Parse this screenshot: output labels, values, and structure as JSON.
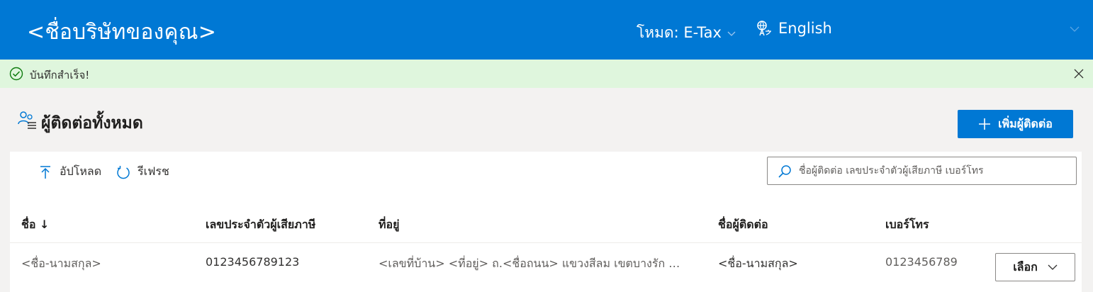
{
  "header": {
    "brand": "<ชื่อบริษัทของคุณ>",
    "mode_label": "โหมด: E-Tax",
    "language": "English",
    "icons": {
      "mode_dropdown": "chevron-down-icon",
      "language": "globe-translate-icon",
      "collapse": "chevron-down-icon"
    }
  },
  "message_bar": {
    "text": "บันทึกสำเร็จ!",
    "icons": {
      "status": "check-circle-icon",
      "dismiss": "close-icon"
    }
  },
  "page": {
    "title": "ผู้ติดต่อทั้งหมด",
    "title_icon": "contacts-list-icon",
    "add_button": "เพิ่มผู้ติดต่อ"
  },
  "toolbar": {
    "upload_label": "อัปโหลด",
    "refresh_label": "รีเฟรช",
    "search_placeholder": "ชื่อผู้ติดต่อ เลขประจำตัวผู้เสียภาษี เบอร์โทร"
  },
  "table": {
    "columns": [
      {
        "label": "ชื่อ ↓"
      },
      {
        "label": "เลขประจำตัวผู้เสียภาษี"
      },
      {
        "label": "ที่อยู่"
      },
      {
        "label": "ชื่อผู้ติดต่อ"
      },
      {
        "label": "เบอร์โทร"
      }
    ],
    "rows": [
      {
        "name": "<ชื่อ-นามสกุล>",
        "tax_id": "0123456789123",
        "address": "<เลขที่บ้าน> <ที่อยู่> ถ.<ชื่อถนน> แขวงสีลม เขตบางรัก จ.กรุงเทพมหานคร",
        "contact_name": "<ชื่อ-นามสกุล>",
        "phone": "0123456789",
        "action_label": "เลือก"
      }
    ]
  },
  "colors": {
    "brand_blue": "#0078d4",
    "success_bg": "#dff6dd",
    "success_icon": "#107c10"
  }
}
